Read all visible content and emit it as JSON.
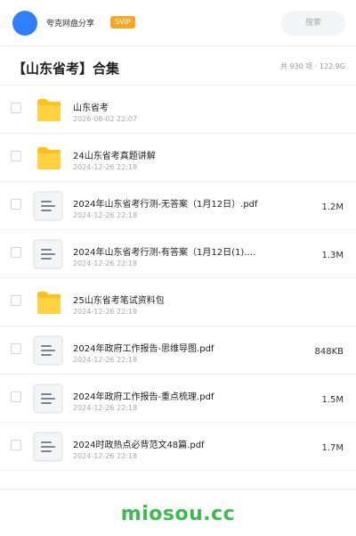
{
  "header": {
    "app_name": "夸克网盘分享",
    "badge": "SVIP",
    "search_placeholder": "搜索"
  },
  "collection": {
    "title": "【山东省考】合集",
    "summary": "共 930 项 · 122.9G"
  },
  "files": [
    {
      "type": "folder",
      "name": "山东省考",
      "date": "2026-06-02 22:07",
      "size": ""
    },
    {
      "type": "folder",
      "name": "24山东省考真题讲解",
      "date": "2024-12-26 22:18",
      "size": ""
    },
    {
      "type": "document",
      "name": "2024年山东省考行测-无答案（1月12日）.pdf",
      "date": "2024-12-26 22:18",
      "size": "1.2M"
    },
    {
      "type": "document",
      "name": "2024年山东省考行测-有答案（1月12日(1).…",
      "date": "2024-12-26 22:18",
      "size": "1.3M"
    },
    {
      "type": "folder",
      "name": "25山东省考笔试资料包",
      "date": "2024-12-26 22:18",
      "size": ""
    },
    {
      "type": "document",
      "name": "2024年政府工作报告-思维导图.pdf",
      "date": "2024-12-26 22:18",
      "size": "848KB"
    },
    {
      "type": "document",
      "name": "2024年政府工作报告-重点梳理.pdf",
      "date": "2024-12-26 22:18",
      "size": "1.5M"
    },
    {
      "type": "document",
      "name": "2024时政热点必背范文48篇.pdf",
      "date": "2024-12-26 22:18",
      "size": "1.7M"
    }
  ],
  "footer": {
    "brand": "miosou.cc"
  },
  "colors": {
    "accent": "#2f80ff",
    "badge": "#f5a623",
    "folder": "#ffc21a",
    "brand": "#3dbb4f"
  }
}
